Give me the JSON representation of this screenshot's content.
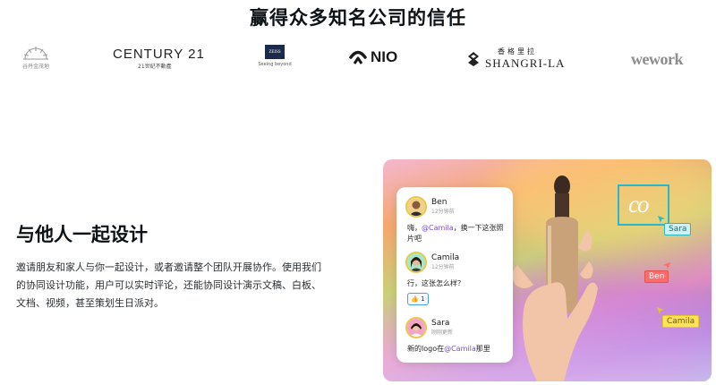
{
  "trust_section": {
    "title": "赢得众多知名公司的信任",
    "logos": [
      {
        "name": "jinmao",
        "label": "谷丹金茂地"
      },
      {
        "name": "century21",
        "label": "CENTURY 21",
        "sublabel": "21世纪不動產"
      },
      {
        "name": "zeiss",
        "label": "ZEISS",
        "sublabel": "Seeing beyond"
      },
      {
        "name": "nio",
        "label": "NIO"
      },
      {
        "name": "shangri-la",
        "label_cn": "香格里拉",
        "label_en": "SHANGRI-LA"
      },
      {
        "name": "wework",
        "label": "wework"
      }
    ]
  },
  "design_section": {
    "heading": "与他人一起设计",
    "body": "邀请朋友和家人与你一起设计，或者邀请整个团队开展协作。使用我们的协同设计功能，用户可以实时评论，还能协同设计演示文稿、白板、文档、视频，甚至策划生日派对。"
  },
  "promo": {
    "canvas_mark": "co",
    "cursor_tags": [
      {
        "label": "Sara",
        "color": "#2ab7c9"
      },
      {
        "label": "Ben",
        "color": "#ff6b6b"
      },
      {
        "label": "Camila",
        "color": "#ffe25a"
      }
    ],
    "comments": [
      {
        "name": "Ben",
        "time": "12分钟前",
        "text_before": "嗨，",
        "mention": "@Camila",
        "text_after": "，换一下这张照片吧"
      },
      {
        "name": "Camila",
        "time": "12分钟前",
        "text": "行，这张怎么样？",
        "reaction": {
          "emoji": "👍",
          "count": "1"
        }
      },
      {
        "name": "Sara",
        "time": "刚刚更新",
        "text_before": "新的logo在",
        "mention": "@Camila",
        "text_after": "那里"
      }
    ]
  },
  "colors": {
    "accent_mention": "#7a4ed1",
    "selection": "#2ab7c9"
  }
}
